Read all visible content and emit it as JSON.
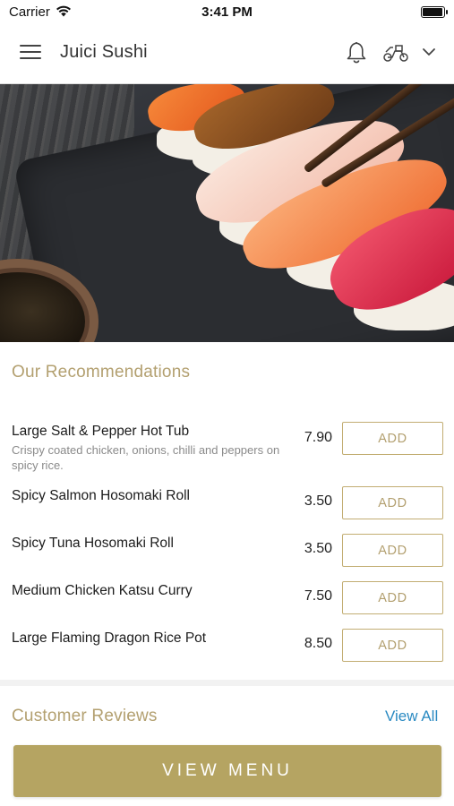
{
  "status_bar": {
    "carrier": "Carrier",
    "time": "3:41 PM",
    "battery_level": 1.0,
    "icons": [
      "wifi-icon",
      "battery-icon"
    ]
  },
  "nav": {
    "title": "Juici Sushi",
    "icons": [
      "menu-icon",
      "bell-icon",
      "scooter-icon",
      "chevron-down-icon"
    ]
  },
  "hero": {
    "icon": "sushi-photo"
  },
  "recommendations": {
    "title": "Our Recommendations",
    "items": [
      {
        "name": "Large Salt & Pepper Hot Tub",
        "description": "Crispy coated chicken, onions, chilli and peppers on spicy rice.",
        "price": "7.90",
        "add_label": "ADD"
      },
      {
        "name": "Spicy Salmon Hosomaki Roll",
        "description": "",
        "price": "3.50",
        "add_label": "ADD"
      },
      {
        "name": "Spicy Tuna Hosomaki Roll",
        "description": "",
        "price": "3.50",
        "add_label": "ADD"
      },
      {
        "name": "Medium Chicken Katsu Curry",
        "description": "",
        "price": "7.50",
        "add_label": "ADD"
      },
      {
        "name": "Large Flaming Dragon Rice Pot",
        "description": "",
        "price": "8.50",
        "add_label": "ADD"
      }
    ]
  },
  "reviews": {
    "title": "Customer Reviews",
    "view_all_label": "View All"
  },
  "footer": {
    "view_menu_label": "VIEW MENU"
  },
  "colors": {
    "accent_gold": "#b5a462",
    "accent_text_gold": "#b3a070",
    "link_blue": "#2a8ac2",
    "divider": "#f2f2f2"
  }
}
